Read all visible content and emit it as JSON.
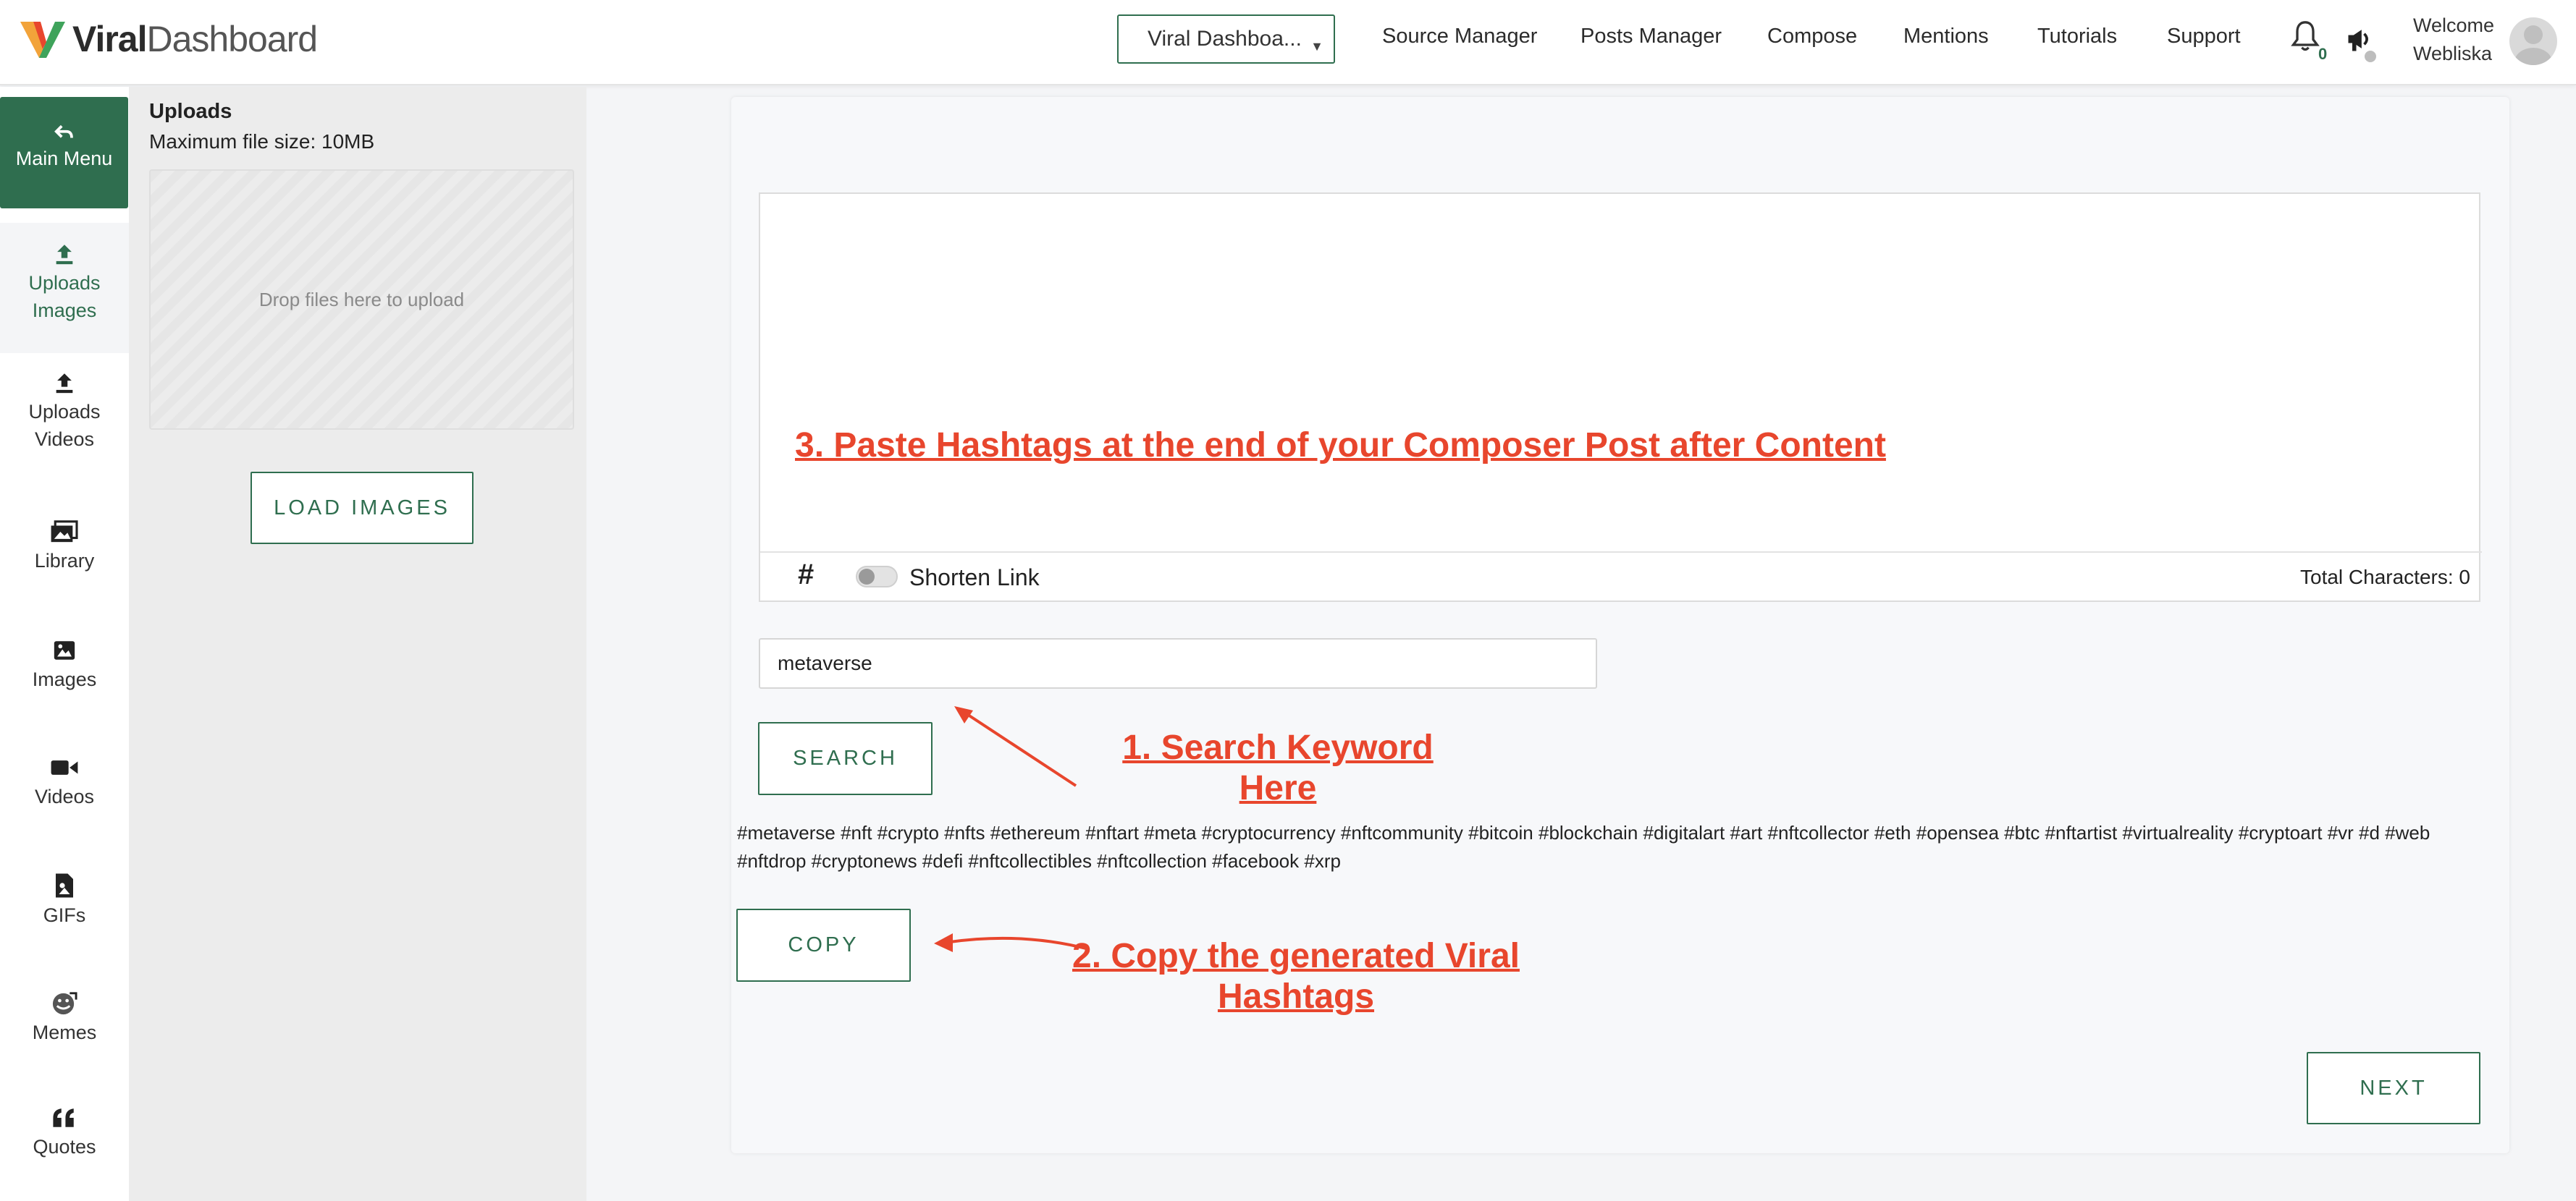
{
  "header": {
    "logo_bold": "Viral",
    "logo_thin": "Dashboard",
    "workspace_selected": "Viral Dashboa...",
    "nav": [
      "Source Manager",
      "Posts Manager",
      "Compose",
      "Mentions",
      "Tutorials",
      "Support"
    ],
    "notification_count": "0",
    "welcome_line1": "Welcome",
    "welcome_line2": "Webliska"
  },
  "rail": {
    "main_menu": "Main Menu",
    "uploads_images": [
      "Uploads",
      "Images"
    ],
    "uploads_videos": [
      "Uploads",
      "Videos"
    ],
    "library": "Library",
    "images": "Images",
    "videos": "Videos",
    "gifs": "GIFs",
    "memes": "Memes",
    "quotes": "Quotes"
  },
  "uploads": {
    "title": "Uploads",
    "max_size": "Maximum file size: 10MB",
    "dropzone_text": "Drop files here to upload",
    "load_button": "LOAD IMAGES"
  },
  "composer": {
    "annotation_paste": "3. Paste Hashtags at the end of your Composer Post after Content",
    "hash_symbol": "#",
    "shorten_link_label": "Shorten Link",
    "shorten_link_on": false,
    "total_characters": "Total Characters: 0"
  },
  "hashtag_tool": {
    "search_value": "metaverse",
    "search_button": "SEARCH",
    "annotation_search_line1": "1. Search Keyword",
    "annotation_search_line2": "Here",
    "hashtags_line1": "#metaverse #nft #crypto #nfts #ethereum #nftart #meta #cryptocurrency #nftcommunity #bitcoin #blockchain #digitalart #art #nftcollector #eth #opensea #btc #nftartist #virtualreality #cryptoart #vr #d #web",
    "hashtags_line2": "#nftdrop #cryptonews #defi #nftcollectibles #nftcollection #facebook #xrp",
    "copy_button": "COPY",
    "annotation_copy_line1": "2. Copy the generated Viral",
    "annotation_copy_line2": "Hashtags",
    "next_button": "NEXT"
  },
  "colors": {
    "brand_green": "#2f6e4f",
    "annotation_red": "#e8462d"
  }
}
